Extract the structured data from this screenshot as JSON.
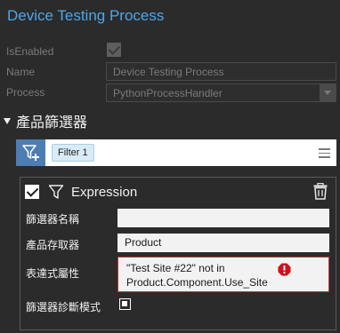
{
  "window": {
    "title": "Device Testing Process"
  },
  "properties": {
    "is_enabled_label": "IsEnabled",
    "name_label": "Name",
    "name_value": "Device Testing Process",
    "process_label": "Process",
    "process_value": "PythonProcessHandler"
  },
  "section": {
    "title": "產品篩選器"
  },
  "filter_bar": {
    "chips": [
      "Filter 1"
    ]
  },
  "expression": {
    "title": "Expression",
    "rows": [
      {
        "label": "篩選器名稱",
        "value": ""
      },
      {
        "label": "產品存取器",
        "value": "Product"
      },
      {
        "label": "表達式屬性",
        "value_line1": "\"Test Site #22\" not in",
        "value_line2": "Product.Component.Use_Site"
      },
      {
        "label": "篩選器診斷模式"
      }
    ]
  },
  "colors": {
    "accent": "#4da6e8",
    "button": "#4d7db3",
    "error": "#d0101c",
    "background": "#2b2b2b"
  },
  "icons": [
    "checkbox-check-icon",
    "dropdown-arrow-icon",
    "expand-triangle-icon",
    "filter-add-icon",
    "menu-icon",
    "filter-icon",
    "trash-icon",
    "error-icon"
  ]
}
